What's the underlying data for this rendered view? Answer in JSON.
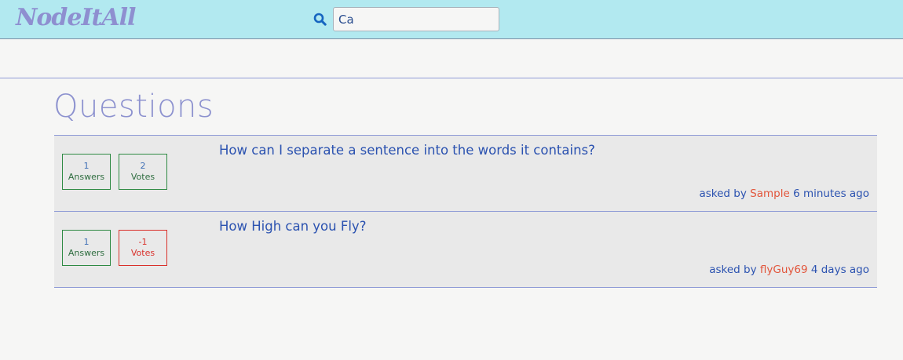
{
  "header": {
    "logo": "NodeItAll",
    "search": {
      "value": "Ca",
      "icon": "search-icon"
    }
  },
  "main": {
    "title": "Questions",
    "questions": [
      {
        "answers": "1",
        "answers_label": "Answers",
        "votes": "2",
        "votes_label": "Votes",
        "title": "How can I separate a sentence into the words it contains?",
        "asked_by_label": "asked by",
        "author": "Sample",
        "time": "6 minutes ago"
      },
      {
        "answers": "1",
        "answers_label": "Answers",
        "votes": "-1",
        "votes_label": "Votes",
        "title": "How High can you Fly?",
        "asked_by_label": "asked by",
        "author": "flyGuy69",
        "time": "4 days ago"
      }
    ]
  },
  "colors": {
    "header_bg": "#b2e9f0",
    "logo": "#8e8fd0",
    "link": "#2b52b0",
    "author": "#e2553b",
    "positive": "#2e8a43",
    "negative": "#d9302a"
  }
}
